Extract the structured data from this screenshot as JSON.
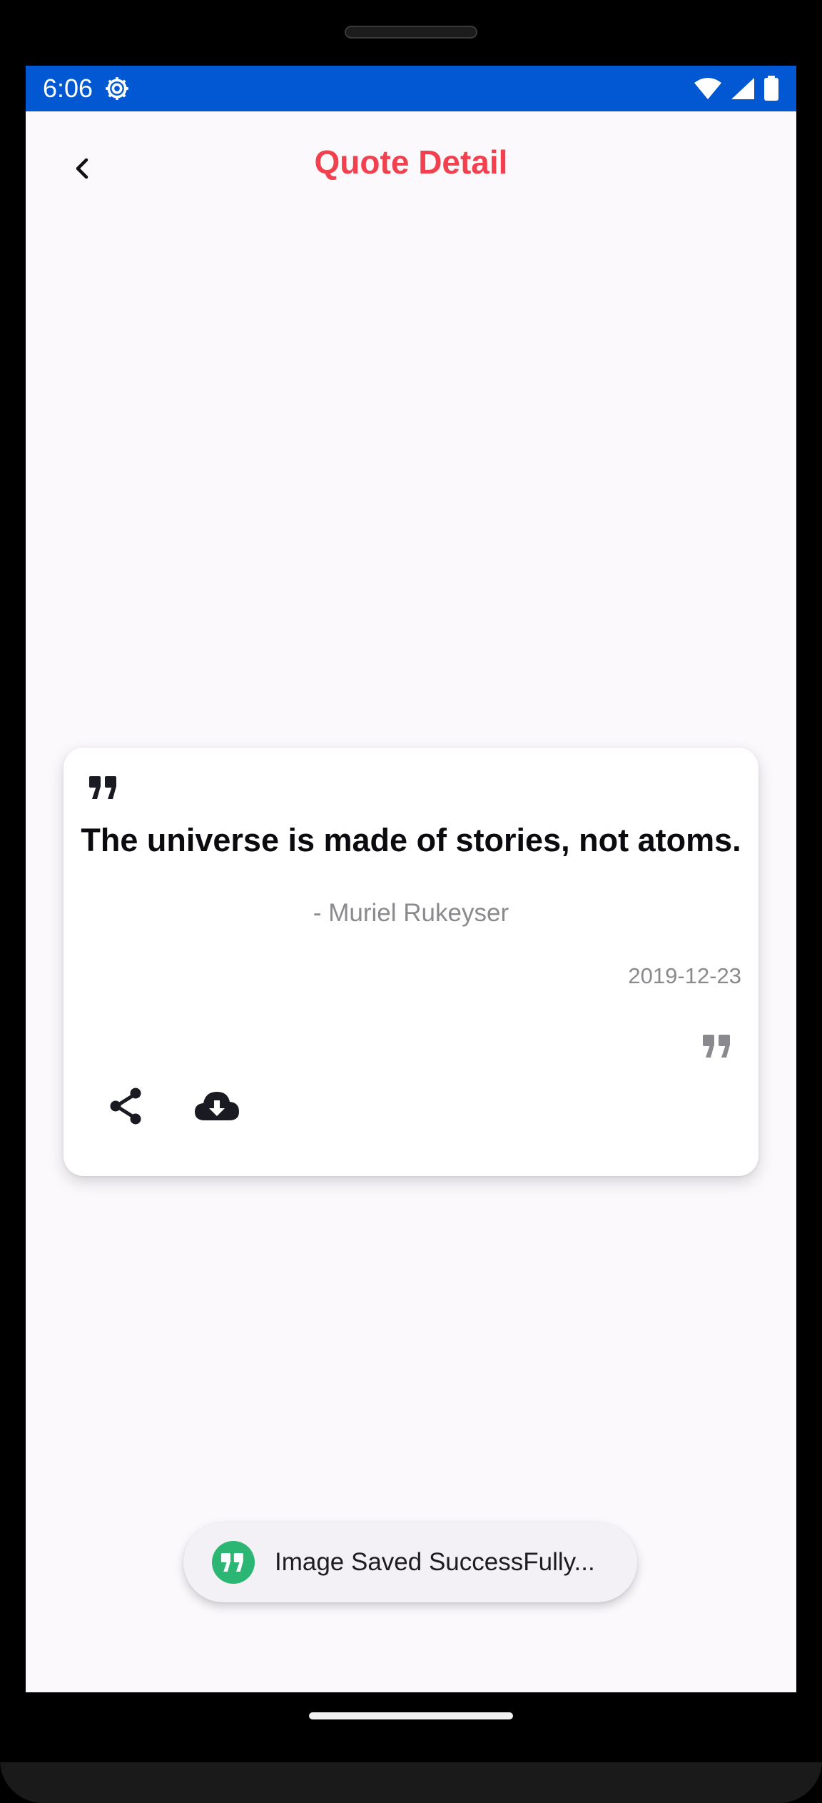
{
  "status_bar": {
    "time": "6:06",
    "background_color": "#0257d2",
    "icons": [
      "settings-gear-icon",
      "wifi-icon",
      "cellular-signal-icon",
      "battery-icon"
    ]
  },
  "app_bar": {
    "title": "Quote Detail",
    "title_color": "#f2404e",
    "back_icon": "chevron-left-icon"
  },
  "quote_card": {
    "text": "The universe is made of stories, not atoms.",
    "author": "- Muriel Rukeyser",
    "date": "2019-12-23",
    "actions": [
      {
        "icon": "share-icon"
      },
      {
        "icon": "cloud-download-icon"
      }
    ]
  },
  "toast": {
    "message": "Image Saved SuccessFully...",
    "icon": "quote-app-icon",
    "icon_color": "#2bb673"
  }
}
